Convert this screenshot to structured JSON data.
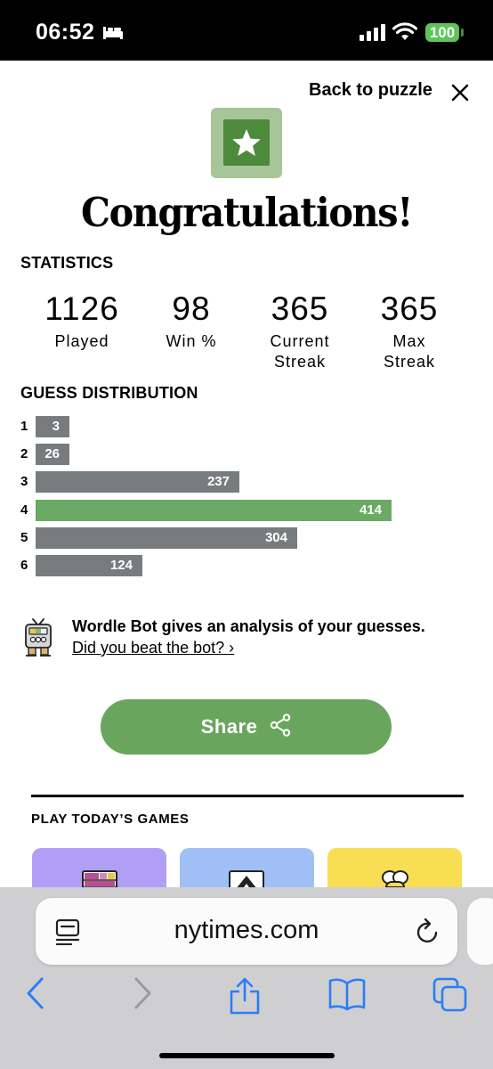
{
  "status_bar": {
    "time": "06:52",
    "battery": "100"
  },
  "header": {
    "back_label": "Back to puzzle"
  },
  "title": "Congratulations!",
  "statistics": {
    "heading": "STATISTICS",
    "items": [
      {
        "value": "1126",
        "label": "Played"
      },
      {
        "value": "98",
        "label": "Win %"
      },
      {
        "value": "365",
        "label": "Current\nStreak"
      },
      {
        "value": "365",
        "label": "Max\nStreak"
      }
    ]
  },
  "distribution": {
    "heading": "GUESS DISTRIBUTION",
    "rows": [
      {
        "guess": "1",
        "count": 3,
        "highlight": false
      },
      {
        "guess": "2",
        "count": 26,
        "highlight": false
      },
      {
        "guess": "3",
        "count": 237,
        "highlight": false
      },
      {
        "guess": "4",
        "count": 414,
        "highlight": true
      },
      {
        "guess": "5",
        "count": 304,
        "highlight": false
      },
      {
        "guess": "6",
        "count": 124,
        "highlight": false
      }
    ]
  },
  "wordle_bot": {
    "title": "Wordle Bot gives an analysis of your guesses.",
    "link": "Did you beat the bot? ›"
  },
  "share": {
    "label": "Share"
  },
  "games": {
    "heading": "PLAY TODAY’S GAMES",
    "cards": [
      {
        "icon": "grid-puzzle-icon",
        "color": "#b19ef5"
      },
      {
        "icon": "mountain-frame-icon",
        "color": "#a0c0f5"
      },
      {
        "icon": "bee-icon",
        "color": "#f7de52"
      }
    ]
  },
  "browser": {
    "url": "nytimes.com"
  },
  "colors": {
    "win_bar": "#6aaa64",
    "bar": "#787c7e",
    "share_button": "#6aa55d"
  }
}
